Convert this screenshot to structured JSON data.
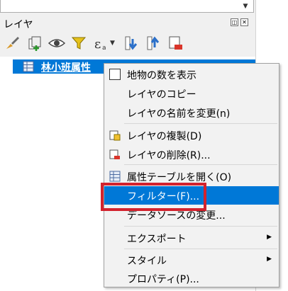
{
  "panel": {
    "title": "レイヤ",
    "float_icon": "float-icon",
    "close_icon": "close-icon"
  },
  "toolbar": {
    "icons": [
      "style-brush-icon",
      "add-group-icon",
      "eye-icon",
      "filter-icon",
      "expression-epsilon-icon",
      "expand-all-icon",
      "collapse-all-icon",
      "remove-layer-icon"
    ]
  },
  "layer": {
    "name": "林小班属性"
  },
  "menu": {
    "items": [
      {
        "label": "地物の数を表示",
        "icon": "checkbox-icon"
      },
      {
        "label": "レイヤのコピー"
      },
      {
        "label": "レイヤの名前を変更(n)"
      },
      {
        "label": "レイヤの複製(D)",
        "icon": "duplicate-layer-icon"
      },
      {
        "label": "レイヤの削除(R)...",
        "icon": "remove-layer-icon"
      },
      {
        "label": "属性テーブルを開く(O)",
        "icon": "attribute-table-icon"
      },
      {
        "label": "フィルター(F)..."
      },
      {
        "label": "データソースの変更..."
      },
      {
        "label": "エクスポート",
        "submenu_icon": "submenu-arrow-icon"
      },
      {
        "label": "スタイル",
        "submenu_icon": "submenu-arrow-icon"
      },
      {
        "label": "プロパティ(P)..."
      }
    ]
  },
  "colors": {
    "selection": "#0078d7",
    "highlight_box": "#d3232e"
  }
}
